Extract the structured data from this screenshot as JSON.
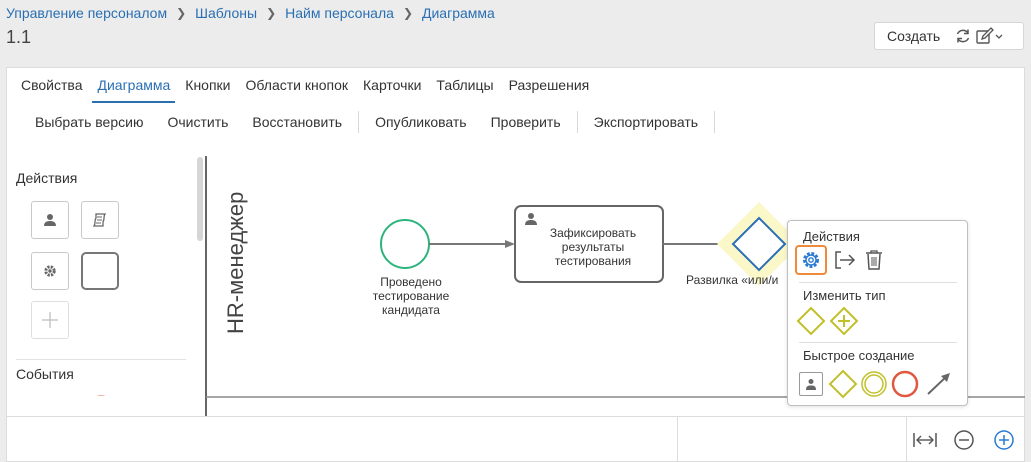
{
  "breadcrumb": {
    "items": [
      "Управление персоналом",
      "Шаблоны",
      "Найм персонала",
      "Диаграмма"
    ]
  },
  "page": {
    "title": "1.1"
  },
  "top_actions": {
    "create_label": "Создать",
    "refresh_icon": "refresh-icon",
    "edit_icon": "edit-dropdown-icon"
  },
  "tabs": [
    {
      "label": "Свойства",
      "active": false
    },
    {
      "label": "Диаграмма",
      "active": true
    },
    {
      "label": "Кнопки",
      "active": false
    },
    {
      "label": "Области кнопок",
      "active": false
    },
    {
      "label": "Карточки",
      "active": false
    },
    {
      "label": "Таблицы",
      "active": false
    },
    {
      "label": "Разрешения",
      "active": false
    }
  ],
  "toolbar": {
    "select_version": "Выбрать версию",
    "clear": "Очистить",
    "restore": "Восстановить",
    "publish": "Опубликовать",
    "check": "Проверить",
    "export": "Экспортировать"
  },
  "palette": {
    "actions_title": "Действия",
    "events_title": "События",
    "action_icons": [
      "user-task-icon",
      "script-task-icon",
      "service-task-icon",
      "generic-task-icon",
      "add-icon"
    ]
  },
  "diagram": {
    "lane_label": "HR-менеджер",
    "start_event_label": "Проведено тестирование кандидата",
    "task_label": "Зафиксировать результаты тестирования",
    "gateway_label": "Развилка «или/и"
  },
  "popup": {
    "actions_title": "Действия",
    "change_type_title": "Изменить тип",
    "quick_create_title": "Быстрое создание",
    "action_icons": [
      "settings-icon",
      "exit-icon",
      "trash-icon"
    ]
  },
  "colors": {
    "link": "#2a6fb3",
    "start_event": "#2db47d",
    "end_event": "#e2573f",
    "gateway": "#2a6fb3",
    "gateway_alt": "#c2c02a",
    "highlight": "#f08a3a"
  }
}
